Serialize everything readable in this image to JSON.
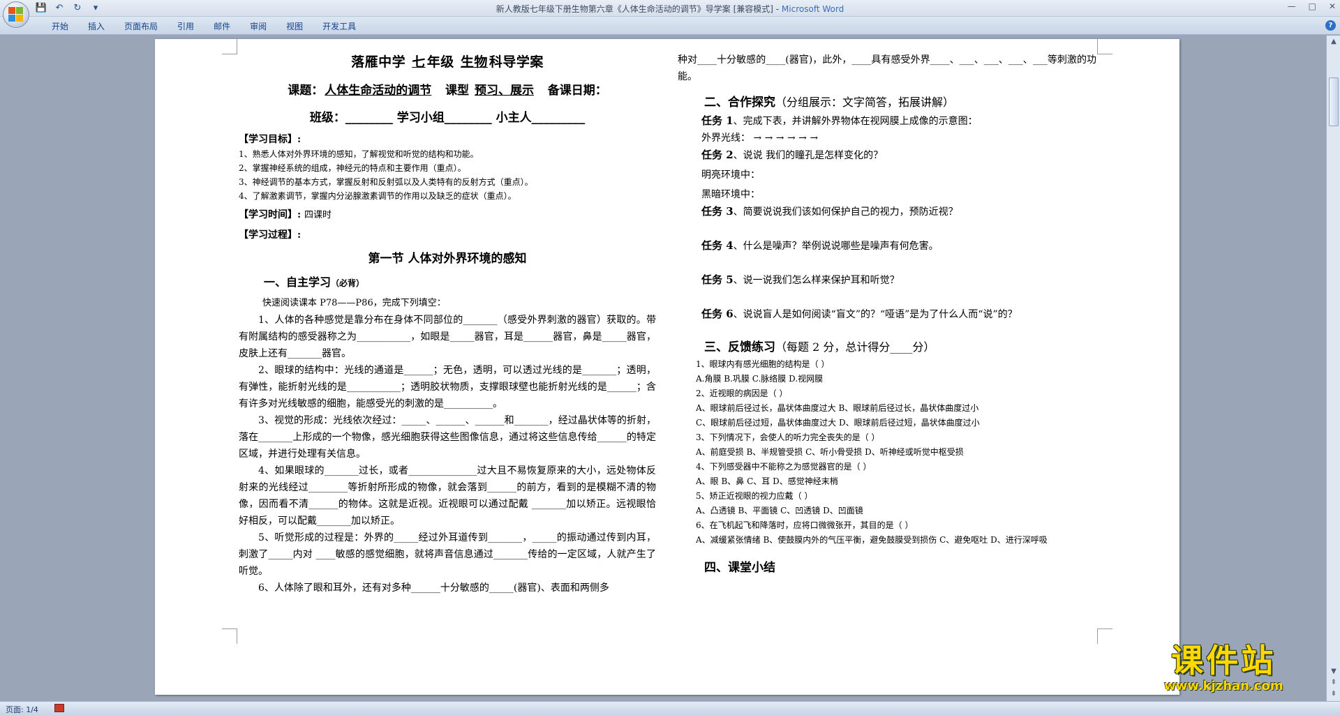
{
  "window": {
    "title": "新人教版七年级下册生物第六章《人体生命活动的调节》导学案 [兼容模式] - ",
    "app_name": "Microsoft Word",
    "controls": [
      "—",
      "□",
      "✕"
    ]
  },
  "ribbon": {
    "tabs": [
      "开始",
      "插入",
      "页面布局",
      "引用",
      "邮件",
      "审阅",
      "视图",
      "开发工具"
    ]
  },
  "status_bar": {
    "page": "页面: 1/4"
  },
  "watermark": {
    "brand": "课件站",
    "url": "www.kjzhan.com"
  },
  "doc": {
    "left": {
      "school_line": [
        "落雁中学",
        "七",
        "年级",
        "生物",
        "科导学案"
      ],
      "topic_label": "课题：",
      "topic": "人体生命活动的调节",
      "type_label": "课型",
      "type": "预习、展示",
      "date_label": "备课日期：",
      "class_line": "班级：________    学习小组________    小主人_________",
      "goals_title": "【学习目标】:",
      "goals": [
        "1、熟悉人体对外界环境的感知，了解视觉和听觉的结构和功能。",
        "2、掌握神经系统的组成，神经元的特点和主要作用（重点）。",
        "3、神经调节的基本方式，掌握反射和反射弧以及人类特有的反射方式（重点）。",
        "4、了解激素调节，掌握内分泌腺激素调节的作用以及缺乏的症状（重点）。"
      ],
      "time_title": "【学习时间】:",
      "time": "四课时",
      "process_title": "【学习过程】:",
      "section_title": "第一节  人体对外界环境的感知",
      "self_study": "一、自主学习",
      "self_study_note": "（必背）",
      "instruction": "快速阅读课本 P78——P86，完成下列填空：",
      "paras": [
        "1、人体的各种感觉是靠分布在身体不同部位的_______（感受外界刺激的器官）获取的。带有附属结构的感受器称之为___________，如眼是_____器官，耳是______器官，鼻是_____器官，皮肤上还有_______器官。",
        "2、眼球的结构中：光线的通道是______；无色，透明，可以透过光线的是_______；透明，有弹性，能折射光线的是___________；透明胶状物质，支撑眼球壁也能折射光线的是______；含有许多对光线敏感的细胞，能感受光的刺激的是__________。",
        "3、视觉的形成：光线依次经过：_____、______、______和_______，经过晶状体等的折射，落在_______上形成的一个物像，感光细胞获得这些图像信息，通过将这些信息传给______的特定区域，并进行处理有关信息。",
        "4、如果眼球的_______过长，或者______________过大且不易恢复原来的大小，远处物体反射来的光线经过________等折射所形成的物像，就会落到______的前方，看到的是模糊不清的物像，因而看不清______的物体。这就是近视。近视眼可以通过配戴 _______加以矫正。远视眼恰好相反，可以配戴_______加以矫正。",
        "5、听觉形成的过程是：外界的_____经过外耳道传到_______，_____的振动通过传到内耳，刺激了_____内对 ____敏感的感觉细胞，就将声音信息通过_______传给的一定区域，人就产生了听觉。",
        "6、人体除了眼和耳外，还有对多种______十分敏感的_____(器官)、表面和两侧多"
      ]
    },
    "right": {
      "cont": "种对____十分敏感的____(器官)，此外，____具有感受外界____、___、___、___、___等刺激的功能。",
      "s2_title": "二、合作探究",
      "s2_note": "（分组展示：文字简答，拓展讲解）",
      "task1_label": "任务 1",
      "task1": "、完成下表，并讲解外界物体在视网膜上成像的示意图：",
      "light_path": "外界光线：      →        →        →        →        →        →",
      "task2_label": "任务 2",
      "task2": "、说说 我们的瞳孔是怎样变化的？",
      "bright": "明亮环境中：",
      "dark": "黑暗环境中：",
      "task3_label": "任务 3",
      "task3": "、简要说说我们该如何保护自己的视力，预防近视？",
      "task4_label": "任务 4",
      "task4": "、什么是噪声？举例说说哪些是噪声有何危害。",
      "task5_label": "任务 5",
      "task5": "、说一说我们怎么样来保护耳和听觉？",
      "task6_label": "任务 6",
      "task6": "、说说盲人是如何阅读“盲文”的？“哑语”是为了什么人而“说”的？",
      "s3_title": "三、反馈练习",
      "s3_note": "（每题 2 分，总计得分____分）",
      "quiz": [
        "1、眼球内有感光细胞的结构是（        ）",
        " A.角膜          B.巩膜          C.脉络膜     D.视网膜",
        "2、近视眼的病因是（        ）",
        "A、眼球前后径过长，晶状体曲度过大       B、眼球前后径过长，晶状体曲度过小",
        "C、眼球前后径过短，晶状体曲度过大       D、眼球前后径过短，晶状体曲度过小",
        "3、下列情况下，会使人的听力完全丧失的是（       ）",
        "A、前庭受损                    B、半规管受损    C、听小骨受损              D、听神经或听觉中枢受损",
        "4、下列感受器中不能称之为感觉器官的是（          ）",
        "A、眼                  B、鼻                    C、耳                  D、感觉神经末梢",
        "5、矫正近视眼的视力应戴（         ）",
        "A、凸透镜      B、平面镜       C、凹透镜       D、凹面镜",
        "6、在飞机起飞和降落时，应将口微微张开，其目的是（          ）",
        "A、减缓紧张情绪   B、使鼓膜内外的气压平衡，避免鼓膜受到损伤 C、避免呕吐 D、进行深呼吸"
      ],
      "s4_title": "四、课堂小结"
    }
  }
}
